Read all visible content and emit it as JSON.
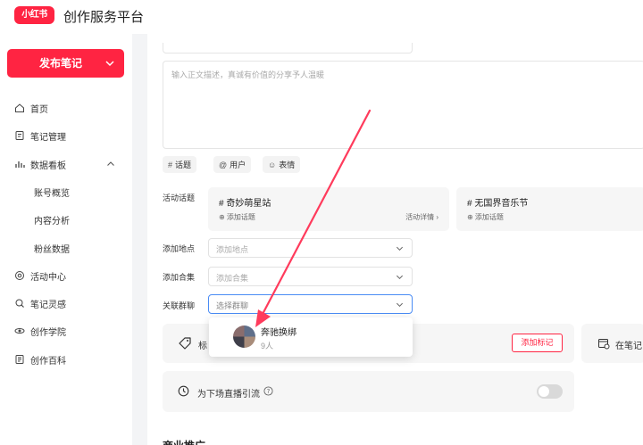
{
  "header": {
    "logo_text": "小红书",
    "title": "创作服务平台"
  },
  "sidebar": {
    "publish_label": "发布笔记",
    "items": [
      {
        "label": "首页",
        "icon": "home-icon"
      },
      {
        "label": "笔记管理",
        "icon": "note-icon"
      },
      {
        "label": "数据看板",
        "icon": "bar-chart-icon"
      },
      {
        "label": "账号概览"
      },
      {
        "label": "内容分析"
      },
      {
        "label": "粉丝数据"
      },
      {
        "label": "活动中心",
        "icon": "activity-icon"
      },
      {
        "label": "笔记灵感",
        "icon": "inspiration-icon"
      },
      {
        "label": "创作学院",
        "icon": "academy-icon"
      },
      {
        "label": "创作百科",
        "icon": "wiki-icon"
      }
    ]
  },
  "editor": {
    "placeholder": "输入正文描述，真诚有价值的分享予人温暖",
    "chips": [
      {
        "glyph": "#",
        "label": "话题"
      },
      {
        "glyph": "@",
        "label": "用户"
      },
      {
        "glyph": "☺",
        "label": "表情"
      }
    ]
  },
  "form": {
    "activity_label": "活动话题",
    "activities": [
      {
        "title": "# 奇妙萌星站",
        "add": "⊕ 添加话题",
        "detail": "活动详情  ›"
      },
      {
        "title": "# 无国界音乐节",
        "add": "⊕ 添加话题"
      }
    ],
    "location_label": "添加地点",
    "location_placeholder": "添加地点",
    "collection_label": "添加合集",
    "collection_placeholder": "添加合集",
    "group_label": "关联群聊",
    "group_placeholder": "选择群聊"
  },
  "group_dropdown": {
    "name": "奔驰换绑",
    "count": "9人"
  },
  "mark_card": {
    "text": "标",
    "add_button": "添加标记"
  },
  "notes_card": {
    "text": "在笔记"
  },
  "live_card": {
    "text": "为下场直播引流",
    "enabled": false
  },
  "bottom_heading": "商业推广",
  "colors": {
    "brand": "#ff2442",
    "focus": "#4a8cf5",
    "arrow": "#ff3b5c"
  }
}
